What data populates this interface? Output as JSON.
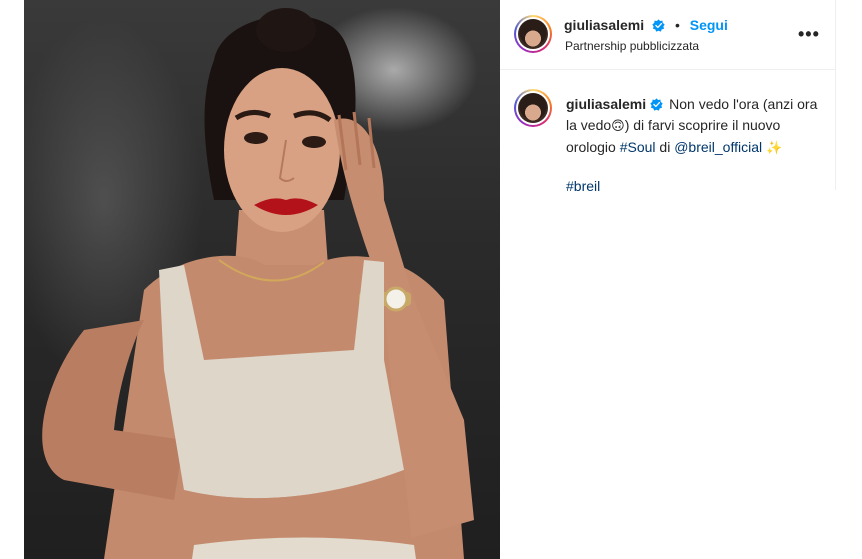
{
  "post": {
    "username": "giuliasalemi",
    "follow_label": "Segui",
    "separator": "•",
    "subtitle": "Partnership pubblicizzata",
    "more_label": "•••"
  },
  "caption": {
    "username": "giuliasalemi",
    "text_part1": "Non vedo l'ora (anzi ora la vedo",
    "emoji1": "🙃",
    "text_part2": ") di farvi scoprire il nuovo orologio ",
    "hashtag_soul": "#Soul",
    "text_part3": " di ",
    "mention": "@breil_official",
    "emoji2": "✨",
    "hashtag_breil": "#breil"
  },
  "colors": {
    "follow": "#0095f6",
    "verified": "#0095f6",
    "link": "#00376b"
  },
  "icons": {
    "verified": "verified-badge-icon",
    "more": "more-options-icon"
  }
}
